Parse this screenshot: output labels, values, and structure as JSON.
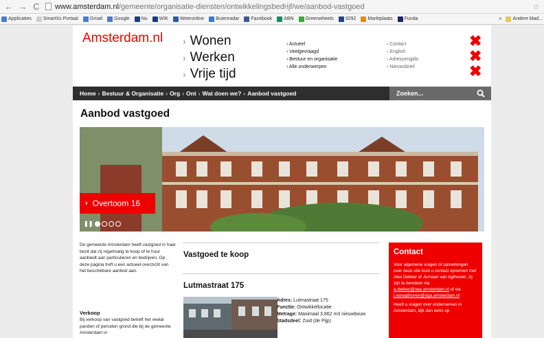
{
  "browser": {
    "url_host": "www.amsterdam.nl",
    "url_path": "/gemeente/organisatie-diensten/ontwikkelingsbedrijf/we/aanbod-vastgoed",
    "bookmarks": [
      {
        "label": "Applicaties",
        "color": "#4a7bd0"
      },
      {
        "label": "SmartXs Portaal",
        "color": "#cfcfcf"
      },
      {
        "label": "Gmail",
        "color": "#4a7bd0"
      },
      {
        "label": "Google",
        "color": "#4a7bd0"
      },
      {
        "label": "Nu",
        "color": "#1a3d7a"
      },
      {
        "label": "WIK",
        "color": "#1a3d7a"
      },
      {
        "label": "Weeronline",
        "color": "#2a5aa8"
      },
      {
        "label": "Buienradar",
        "color": "#3a7ad0"
      },
      {
        "label": "Facebook",
        "color": "#3b5998"
      },
      {
        "label": "ABN",
        "color": "#138a6a"
      },
      {
        "label": "Greenwheels",
        "color": "#3aa83a"
      },
      {
        "label": "9292",
        "color": "#224488"
      },
      {
        "label": "Marktplaats",
        "color": "#e08a1a"
      },
      {
        "label": "Funda",
        "color": "#222266"
      }
    ],
    "more": "»",
    "other_bookmarks": "Andere blad..."
  },
  "site": {
    "logo": "Amsterdam.nl",
    "mainnav": [
      "Wonen",
      "Werken",
      "Vrije tijd"
    ],
    "sub_col1": [
      "Actueel",
      "Veelgevraagd",
      "Bestuur en organisatie",
      "Alle onderwerpen"
    ],
    "sub_col2": [
      "Contact",
      "English",
      "Adressengids",
      "Nieuwsbrief"
    ],
    "breadcrumb": [
      "Home",
      "Bestuur & Organisatie",
      "Org",
      "Ont",
      "Wat doen we?",
      "Aanbod vastgoed"
    ],
    "search_placeholder": "Zoeken...",
    "page_title": "Aanbod vastgoed",
    "hero_caption": "Overtoom 16",
    "intro": "De gemeente Amsterdam heeft vastgoed in haar bezit dat zij regelmatig te koop of te huur aanbiedt aan particulieren en bedrijven. Op deze pagina treft u een actueel overzicht van het beschikbare aanbod aan.",
    "verkoop_heading": "Verkoop",
    "verkoop_text": "Bij verkoop van vastgoed betreft het veelal panden of percelen grond die bij de gemeente Amsterdam in",
    "section1": "Vastgoed te koop",
    "section2": "Lutmastraat 175",
    "props": {
      "adres_label": "Adres:",
      "adres": "Lutmastraat 175",
      "functie_label": "Functie:",
      "functie": "Ontwikkellocatie",
      "metrage_label": "Metrage:",
      "metrage": "Maximaal 3.862 m3 nieuwbouw",
      "stadsdeel_label": "Stadsdeel:",
      "stadsdeel": "Zuid (de Pijp)"
    },
    "contact": {
      "title": "Contact",
      "text_a": "Voor algemene vragen of opmerkingen over deze site kunt u contact opnemen met Alex Dekker of Jurnaan van Agthoven, zij zijn te bereiken via",
      "email1": "a.dekker@oga.amsterdam.nl",
      "text_of": "of via",
      "email2": "j.vanagthoven@oga.amsterdam.nl",
      "text_b": "Heeft u vragen over ondernemen in Amsterdam, kijk dan eens op"
    }
  }
}
